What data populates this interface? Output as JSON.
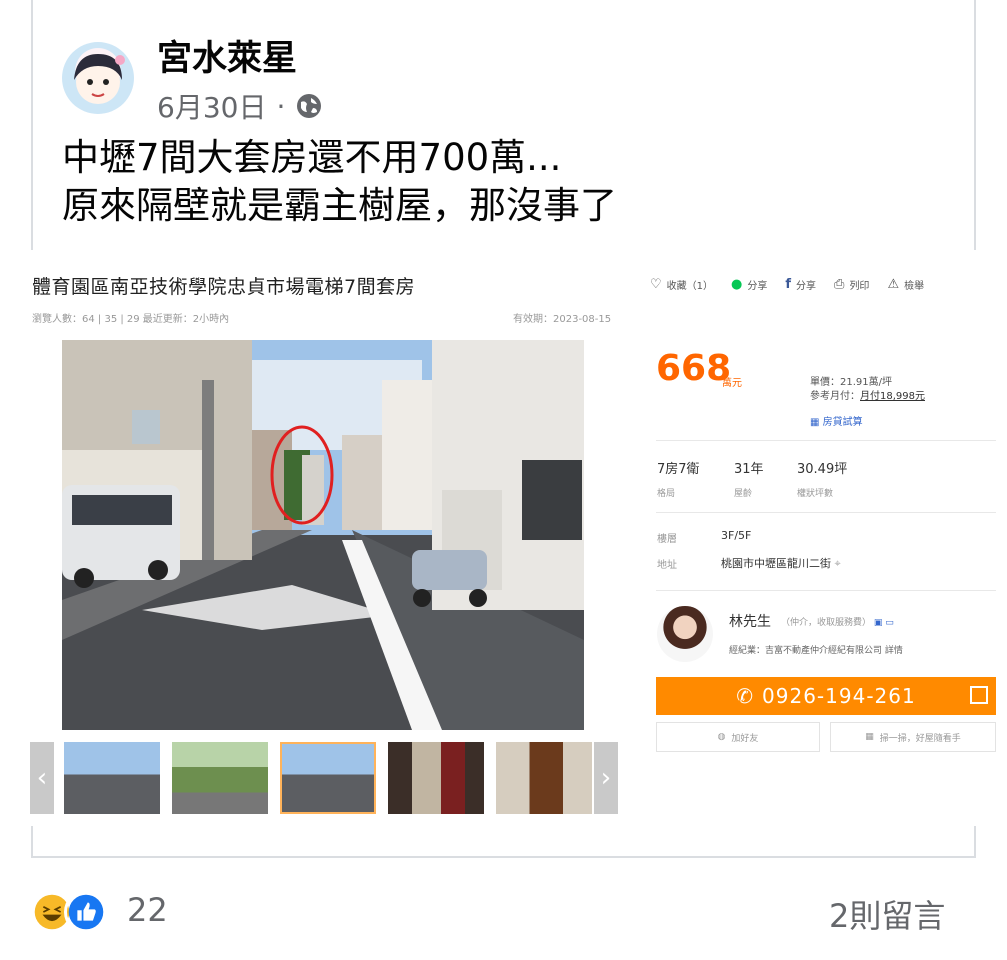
{
  "post": {
    "author": "宮水萊星",
    "date": "6月30日",
    "separator": "·",
    "line1": "中壢7間大套房還不用700萬...",
    "line2": "原來隔壁就是霸主樹屋，那沒事了"
  },
  "listing": {
    "title": "體育園區南亞技術學院忠貞市場電梯7間套房",
    "stats": "瀏覽人數：64  |  35  |  29  最近更新：2小時內",
    "valid": "有效期：2023-08-15",
    "actions": [
      {
        "icon": "heart-icon",
        "label": "收藏（1）"
      },
      {
        "icon": "line-icon",
        "label": "分享"
      },
      {
        "icon": "facebook-icon",
        "label": "分享"
      },
      {
        "icon": "print-icon",
        "label": "列印"
      },
      {
        "icon": "warning-icon",
        "label": "檢舉"
      }
    ],
    "price": "668",
    "price_unit": "萬元",
    "unit_price": "單價：21.91萬/坪",
    "monthly_prefix": "參考月付：",
    "monthly_value": "月付18,998元",
    "calc": "房貸試算",
    "specs": [
      {
        "value": "7房7衛",
        "label": "格局"
      },
      {
        "value": "31年",
        "label": "屋齡"
      },
      {
        "value": "30.49坪",
        "label": "權狀坪數"
      }
    ],
    "floor_label": "樓層",
    "floor_value": "3F/5F",
    "address_label": "地址",
    "address_value": "桃園市中壢區龍川二街",
    "agent_name": "林先生",
    "agent_tag": "（仲介，收取服務費）",
    "agent_company": "經紀業：吉富不動產仲介經紀有限公司 詳情",
    "phone": "0926-194-261",
    "add_friend": "加好友",
    "scan": "掃一掃，好屋隨看手"
  },
  "footer": {
    "reaction_count": "22",
    "comments": "2則留言"
  },
  "colors": {
    "price": "#ff6600",
    "phone_button": "#ff8a00",
    "like_blue": "#1877f2",
    "haha_yellow": "#f7b928"
  }
}
